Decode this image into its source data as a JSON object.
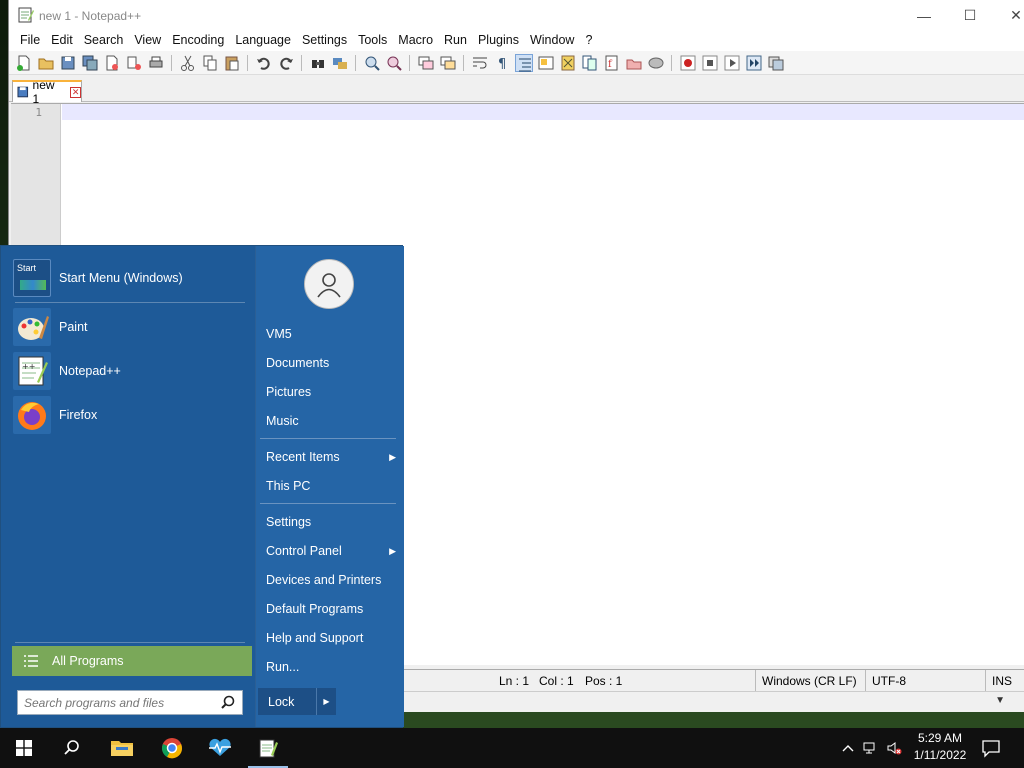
{
  "window": {
    "title": "new 1 - Notepad++",
    "minimize": "—",
    "maximize": "☐",
    "close": "✕"
  },
  "menu": [
    "File",
    "Edit",
    "Search",
    "View",
    "Encoding",
    "Language",
    "Settings",
    "Tools",
    "Macro",
    "Run",
    "Plugins",
    "Window",
    "?"
  ],
  "tab": {
    "label": "new 1",
    "close": "✕"
  },
  "editor": {
    "line_number": "1"
  },
  "statusbar": {
    "ln": "Ln : 1",
    "col": "Col : 1",
    "pos": "Pos : 1",
    "eol": "Windows (CR LF)",
    "encoding": "UTF-8",
    "mode": "INS"
  },
  "start_menu": {
    "programs": [
      {
        "label": "Start Menu (Windows)",
        "icon": "start-menu-icon"
      },
      {
        "label": "Paint",
        "icon": "paint-icon"
      },
      {
        "label": "Notepad++",
        "icon": "notepadpp-icon"
      },
      {
        "label": "Firefox",
        "icon": "firefox-icon"
      }
    ],
    "start_badge": "Start",
    "all_programs": "All Programs",
    "search_placeholder": "Search programs and files",
    "right_items": [
      "VM5",
      "Documents",
      "Pictures",
      "Music",
      "Recent Items",
      "This PC",
      "Settings",
      "Control Panel",
      "Devices and Printers",
      "Default Programs",
      "Help and Support",
      "Run..."
    ],
    "lock": "Lock"
  },
  "taskbar": {
    "time": "5:29 AM",
    "date": "1/11/2022"
  },
  "colors": {
    "start_bg": "#1e5a98",
    "all_programs_bg": "#7aa859",
    "taskbar_bg": "#101010"
  }
}
